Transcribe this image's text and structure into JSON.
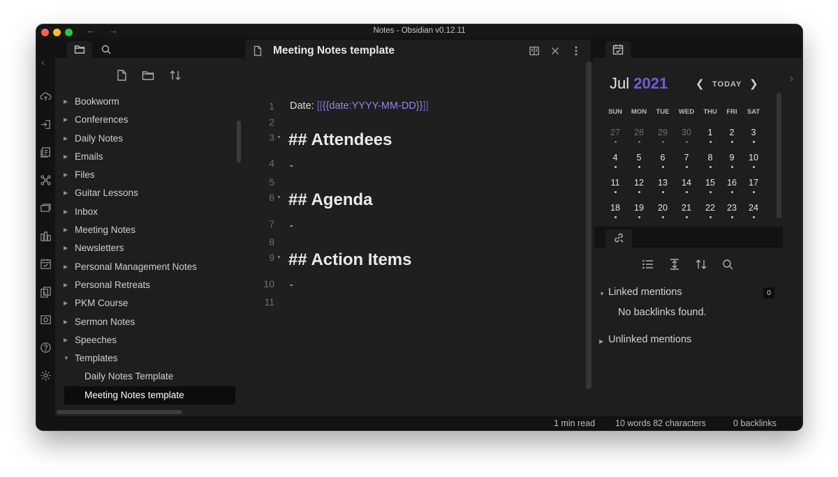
{
  "window": {
    "title": "Notes - Obsidian v0.12.11"
  },
  "file_explorer": {
    "folders": [
      "Bookworm",
      "Conferences",
      "Daily Notes",
      "Emails",
      "Files",
      "Guitar Lessons",
      "Inbox",
      "Meeting Notes",
      "Newsletters",
      "Personal Management Notes",
      "Personal Retreats",
      "PKM Course",
      "Sermon Notes",
      "Speeches",
      "Templates"
    ],
    "template_files": [
      "Daily Notes Template",
      "Meeting Notes template"
    ],
    "active_file": "Meeting Notes template"
  },
  "editor": {
    "tab_title": "Meeting Notes template",
    "line_numbers": [
      "1",
      "2",
      "3",
      "4",
      "5",
      "6",
      "7",
      "8",
      "9",
      "10",
      "11"
    ],
    "date_label": "Date: ",
    "date_open": "[[",
    "date_template": "{{date:YYYY-MM-DD}}",
    "date_close": "]]",
    "headings": [
      "## Attendees",
      "## Agenda",
      "## Action Items"
    ],
    "bullet": "-"
  },
  "calendar": {
    "month": "Jul",
    "year": "2021",
    "today_label": "TODAY",
    "weekdays": [
      "SUN",
      "MON",
      "TUE",
      "WED",
      "THU",
      "FRI",
      "SAT"
    ],
    "weeks": [
      [
        "27",
        "28",
        "29",
        "30",
        "1",
        "2",
        "3"
      ],
      [
        "4",
        "5",
        "6",
        "7",
        "8",
        "9",
        "10"
      ],
      [
        "11",
        "12",
        "13",
        "14",
        "15",
        "16",
        "17"
      ],
      [
        "18",
        "19",
        "20",
        "21",
        "22",
        "23",
        "24"
      ]
    ],
    "accent_color": "#6e5fdb"
  },
  "backlinks": {
    "linked_label": "Linked mentions",
    "linked_count": "0",
    "empty_text": "No backlinks found.",
    "unlinked_label": "Unlinked mentions"
  },
  "status_bar": {
    "read_time": "1 min read",
    "word_count": "10 words 82 characters",
    "backlinks": "0 backlinks"
  }
}
